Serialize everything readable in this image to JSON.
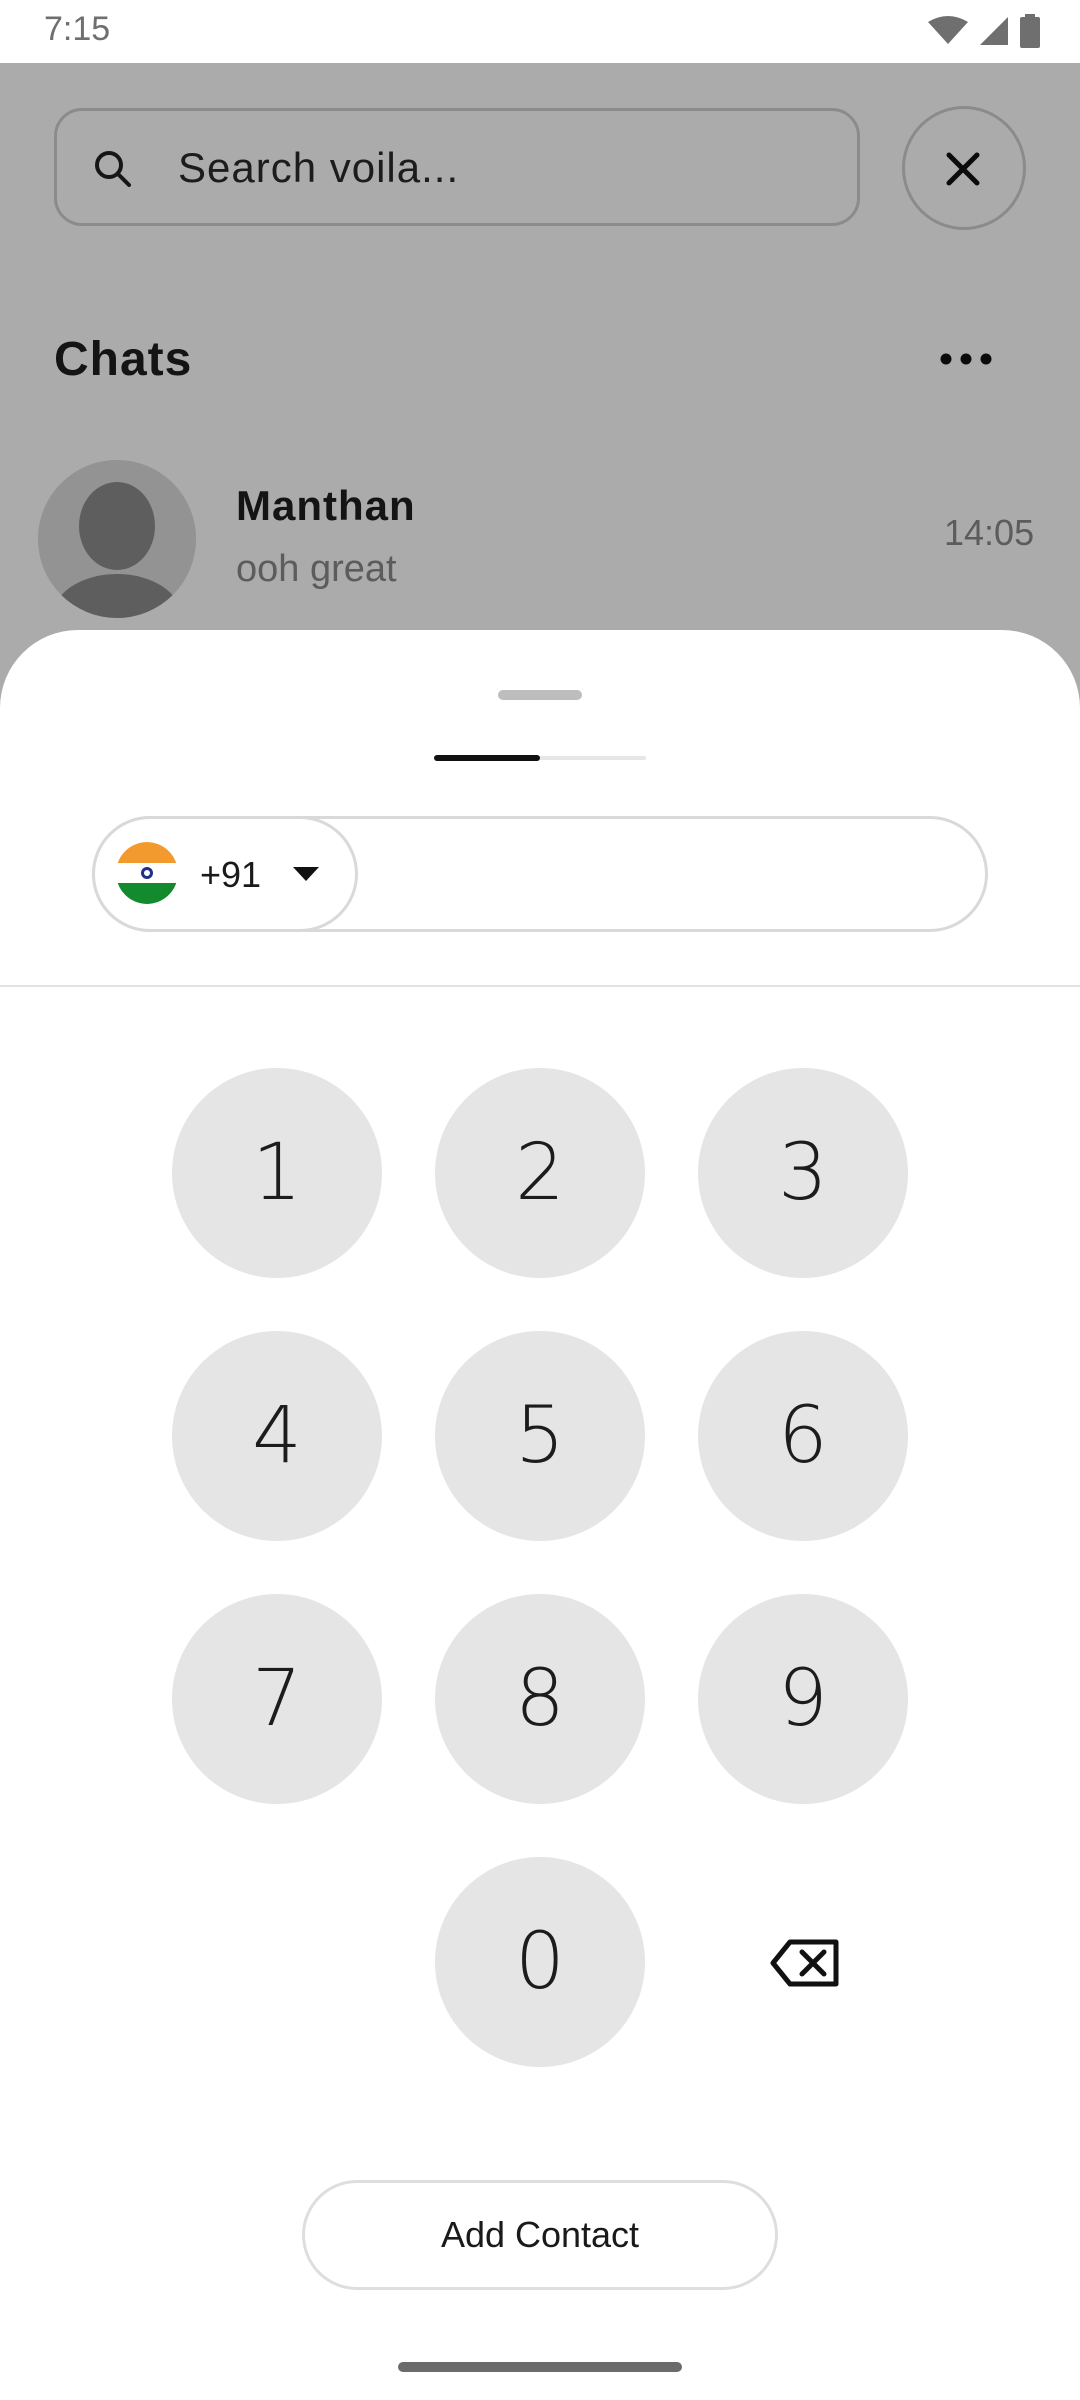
{
  "status_bar": {
    "time": "7:15",
    "icons": [
      "wifi-icon",
      "signal-icon",
      "battery-icon"
    ]
  },
  "background": {
    "search": {
      "placeholder": "Search voila..."
    },
    "chats_title": "Chats",
    "chat_item": {
      "name": "Manthan",
      "message": "ooh great",
      "time": "14:05"
    }
  },
  "sheet": {
    "progress": 0.5,
    "country": {
      "flag": "india-flag-icon",
      "code": "+91"
    },
    "phone_value": "",
    "keypad": [
      {
        "label": "1"
      },
      {
        "label": "2"
      },
      {
        "label": "3"
      },
      {
        "label": "4"
      },
      {
        "label": "5"
      },
      {
        "label": "6"
      },
      {
        "label": "7"
      },
      {
        "label": "8"
      },
      {
        "label": "9"
      },
      {
        "label": "0"
      }
    ],
    "add_contact_label": "Add Contact"
  },
  "colors": {
    "scrim": "#000000",
    "key_background": "#e5e5e5",
    "progress_active": "#111111"
  }
}
